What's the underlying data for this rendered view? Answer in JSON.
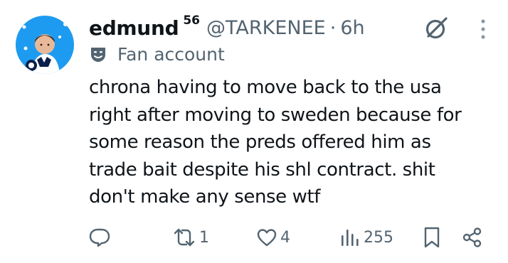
{
  "tweet": {
    "author": {
      "display_name": "edmund",
      "name_superscript": "56",
      "handle": "@TARKENEE",
      "separator": "·",
      "time": "6h",
      "label": "Fan account"
    },
    "text_lines": [
      "chrona having to move back to the usa",
      "right after moving to sweden because for",
      "some reason the preds offered him as",
      "trade bait despite his shl contract. shit",
      "don't make any sense wtf"
    ],
    "actions": {
      "reply": {
        "icon": "reply-icon",
        "count": ""
      },
      "repost": {
        "icon": "repost-icon",
        "count": "1"
      },
      "like": {
        "icon": "heart-icon",
        "count": "4"
      },
      "views": {
        "icon": "views-icon",
        "count": "255"
      },
      "bookmark": {
        "icon": "bookmark-icon"
      },
      "share": {
        "icon": "share-icon"
      }
    }
  },
  "colors": {
    "text": "#0f1419",
    "secondary": "#536471",
    "avatar_bg": "#1d9bf0"
  }
}
